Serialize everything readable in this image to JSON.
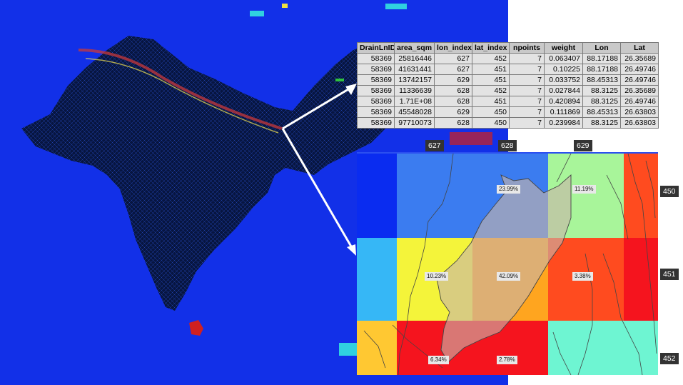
{
  "table": {
    "columns": [
      "DrainLnID",
      "area_sqm",
      "lon_index",
      "lat_index",
      "npoints",
      "weight",
      "Lon",
      "Lat"
    ],
    "rows": [
      [
        "58369",
        "25816446",
        "627",
        "452",
        "7",
        "0.063407",
        "88.17188",
        "26.35689"
      ],
      [
        "58369",
        "41631441",
        "627",
        "451",
        "7",
        "0.10225",
        "88.17188",
        "26.49746"
      ],
      [
        "58369",
        "13742157",
        "629",
        "451",
        "7",
        "0.033752",
        "88.45313",
        "26.49746"
      ],
      [
        "58369",
        "11336639",
        "628",
        "452",
        "7",
        "0.027844",
        "88.3125",
        "26.35689"
      ],
      [
        "58369",
        "1.71E+08",
        "628",
        "451",
        "7",
        "0.420894",
        "88.3125",
        "26.49746"
      ],
      [
        "58369",
        "45548028",
        "629",
        "450",
        "7",
        "0.111869",
        "88.45313",
        "26.63803"
      ],
      [
        "58369",
        "97710073",
        "628",
        "450",
        "7",
        "0.239984",
        "88.3125",
        "26.63803"
      ]
    ]
  },
  "grid": {
    "lon_labels": [
      "627",
      "628",
      "629"
    ],
    "lat_labels": [
      "450",
      "451",
      "452"
    ],
    "cell_colors": [
      [
        "#0a2cf0",
        "#3b7cf0",
        "#3b7cf0",
        "#a8f59a",
        "#ff4b1f"
      ],
      [
        "#36b7f6",
        "#f4f43a",
        "#ffa51f",
        "#ff4b1f",
        "#f5141e"
      ],
      [
        "#ffc832",
        "#f5141e",
        "#f5141e",
        "#6ef5d2",
        "#6ef5d2"
      ]
    ],
    "percentages": [
      "23.99%",
      "11.19%",
      "10.23%",
      "42.09%",
      "3.38%",
      "6.34%",
      "2.78%"
    ]
  },
  "colors": {
    "ocean": "#1230e8",
    "land": "#05123a",
    "arrow": "#ffffff",
    "catchment_overlay": "#c8b4aa"
  }
}
